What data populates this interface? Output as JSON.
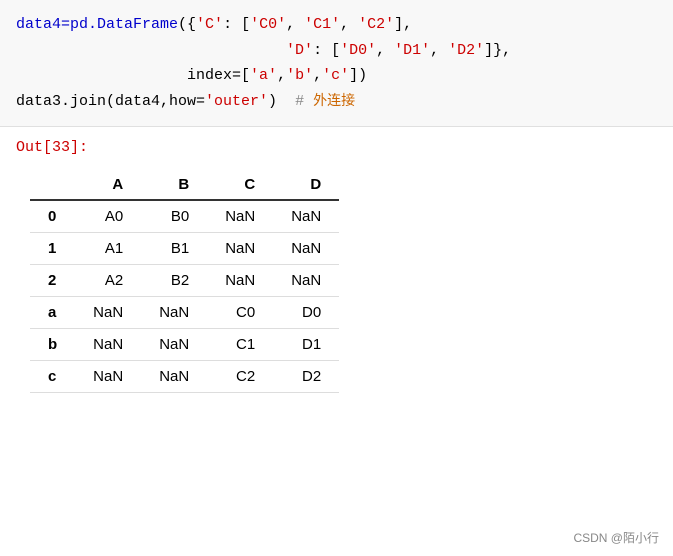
{
  "code": {
    "lines": [
      {
        "parts": [
          {
            "text": "data4=pd.DataFrame({'C': ['C0', 'C1', 'C2'],",
            "type": "mixed"
          }
        ]
      },
      {
        "parts": [
          {
            "text": "                              'D': ['D0', 'D1', 'D2']},",
            "type": "mixed"
          }
        ]
      },
      {
        "parts": [
          {
            "text": "                   index=['a','b','c'])",
            "type": "mixed"
          }
        ]
      },
      {
        "parts": [
          {
            "text": "data3.join(data4,how='outer')  # 外连接",
            "type": "mixed"
          }
        ]
      }
    ]
  },
  "output_label": "Out[33]:",
  "table": {
    "headers": [
      "",
      "A",
      "B",
      "C",
      "D"
    ],
    "rows": [
      [
        "0",
        "A0",
        "B0",
        "NaN",
        "NaN"
      ],
      [
        "1",
        "A1",
        "B1",
        "NaN",
        "NaN"
      ],
      [
        "2",
        "A2",
        "B2",
        "NaN",
        "NaN"
      ],
      [
        "a",
        "NaN",
        "NaN",
        "C0",
        "D0"
      ],
      [
        "b",
        "NaN",
        "NaN",
        "C1",
        "D1"
      ],
      [
        "c",
        "NaN",
        "NaN",
        "C2",
        "D2"
      ]
    ]
  },
  "watermark": "CSDN @陌小行"
}
